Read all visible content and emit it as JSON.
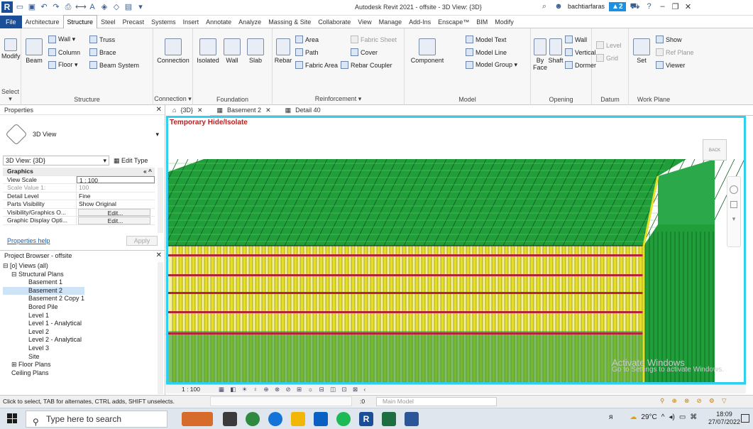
{
  "titlebar": {
    "title": "Autodesk Revit 2021 - offsite - 3D View: {3D}",
    "user": "bachtiarfaras",
    "notifications": "2"
  },
  "menu": {
    "tabs": [
      "File",
      "Architecture",
      "Structure",
      "Steel",
      "Precast",
      "Systems",
      "Insert",
      "Annotate",
      "Analyze",
      "Massing & Site",
      "Collaborate",
      "View",
      "Manage",
      "Add-Ins",
      "Enscape™",
      "BIM",
      "Modify"
    ],
    "active": "Structure"
  },
  "ribbon": {
    "select": {
      "modify": "Modify",
      "label": "Select ▾"
    },
    "structure": {
      "beam": "Beam",
      "wall": "Wall ▾",
      "truss": "Truss",
      "column": "Column",
      "brace": "Brace",
      "floor": "Floor ▾",
      "beam_system": "Beam System",
      "label": "Structure"
    },
    "connection": {
      "btn": "Connection",
      "label": "Connection ▾"
    },
    "foundation": {
      "isolated": "Isolated",
      "wall": "Wall",
      "slab": "Slab",
      "label": "Foundation"
    },
    "reinforcement": {
      "rebar": "Rebar",
      "area": "Area",
      "path": "Path",
      "fabric_area": "Fabric Area",
      "fabric_sheet": "Fabric Sheet",
      "cover": "Cover",
      "rebar_coupler": "Rebar Coupler",
      "label": "Reinforcement ▾"
    },
    "model": {
      "component": "Component",
      "model_text": "Model Text",
      "model_line": "Model Line",
      "model_group": "Model Group ▾",
      "label": "Model"
    },
    "opening": {
      "by_face": "By Face",
      "shaft": "Shaft",
      "wall": "Wall",
      "vertical": "Vertical",
      "dormer": "Dormer",
      "label": "Opening"
    },
    "datum": {
      "level": "Level",
      "grid": "Grid",
      "label": "Datum"
    },
    "workplane": {
      "set": "Set",
      "show": "Show",
      "ref_plane": "Ref Plane",
      "viewer": "Viewer",
      "label": "Work Plane"
    }
  },
  "properties": {
    "title": "Properties",
    "type_name": "3D View",
    "view_selector": "3D View: {3D}",
    "edit_type": "Edit Type",
    "group": "Graphics",
    "rows": [
      {
        "k": "View Scale",
        "v": "1 : 100"
      },
      {
        "k": "Scale Value  1:",
        "v": "100"
      },
      {
        "k": "Detail Level",
        "v": "Fine"
      },
      {
        "k": "Parts Visibility",
        "v": "Show Original"
      },
      {
        "k": "Visibility/Graphics O...",
        "v": "Edit..."
      },
      {
        "k": "Graphic Display Opti...",
        "v": "Edit..."
      }
    ],
    "help": "Properties help",
    "apply": "Apply"
  },
  "browser": {
    "title": "Project Browser - offsite",
    "nodes": [
      {
        "t": "⊟ [o]  Views (all)",
        "d": 0
      },
      {
        "t": "⊟ Structural Plans",
        "d": 1
      },
      {
        "t": "Basement 1",
        "d": 3
      },
      {
        "t": "Basement 2",
        "d": 3
      },
      {
        "t": "Basement 2 Copy 1",
        "d": 3
      },
      {
        "t": "Bored Pile",
        "d": 3
      },
      {
        "t": "Level 1",
        "d": 3
      },
      {
        "t": "Level 1 - Analytical",
        "d": 3
      },
      {
        "t": "Level 2",
        "d": 3
      },
      {
        "t": "Level 2 - Analytical",
        "d": 3
      },
      {
        "t": "Level 3",
        "d": 3
      },
      {
        "t": "Site",
        "d": 3
      },
      {
        "t": "⊞ Floor Plans",
        "d": 1
      },
      {
        "t": "Ceiling Plans",
        "d": 1
      }
    ],
    "selected": "Basement 2"
  },
  "view_tabs": [
    {
      "label": "{3D}",
      "active": true
    },
    {
      "label": "Basement 2",
      "active": false
    },
    {
      "label": "Detail 40",
      "active": false
    }
  ],
  "canvas": {
    "banner": "Temporary Hide/Isolate",
    "viewcube": "BACK",
    "watermark_1": "Activate Windows",
    "watermark_2": "Go to Settings to activate Windows."
  },
  "viewbar": {
    "scale": "1 : 100"
  },
  "status": {
    "message": "Click to select, TAB for alternates, CTRL adds, SHIFT unselects.",
    "zero": ":0",
    "model": "Main Model"
  },
  "taskbar": {
    "search": "Type here to search",
    "temp": "29°C",
    "time": "18:09",
    "date": "27/07/2022"
  },
  "colors": {
    "accent": "#1a4e96",
    "canvas_border": "#2fd0ef",
    "mesh_green": "#1f9e3a",
    "rebar_yellow": "#e6df26",
    "rebar_red": "#b3233a",
    "banner_red": "#b7201e"
  }
}
